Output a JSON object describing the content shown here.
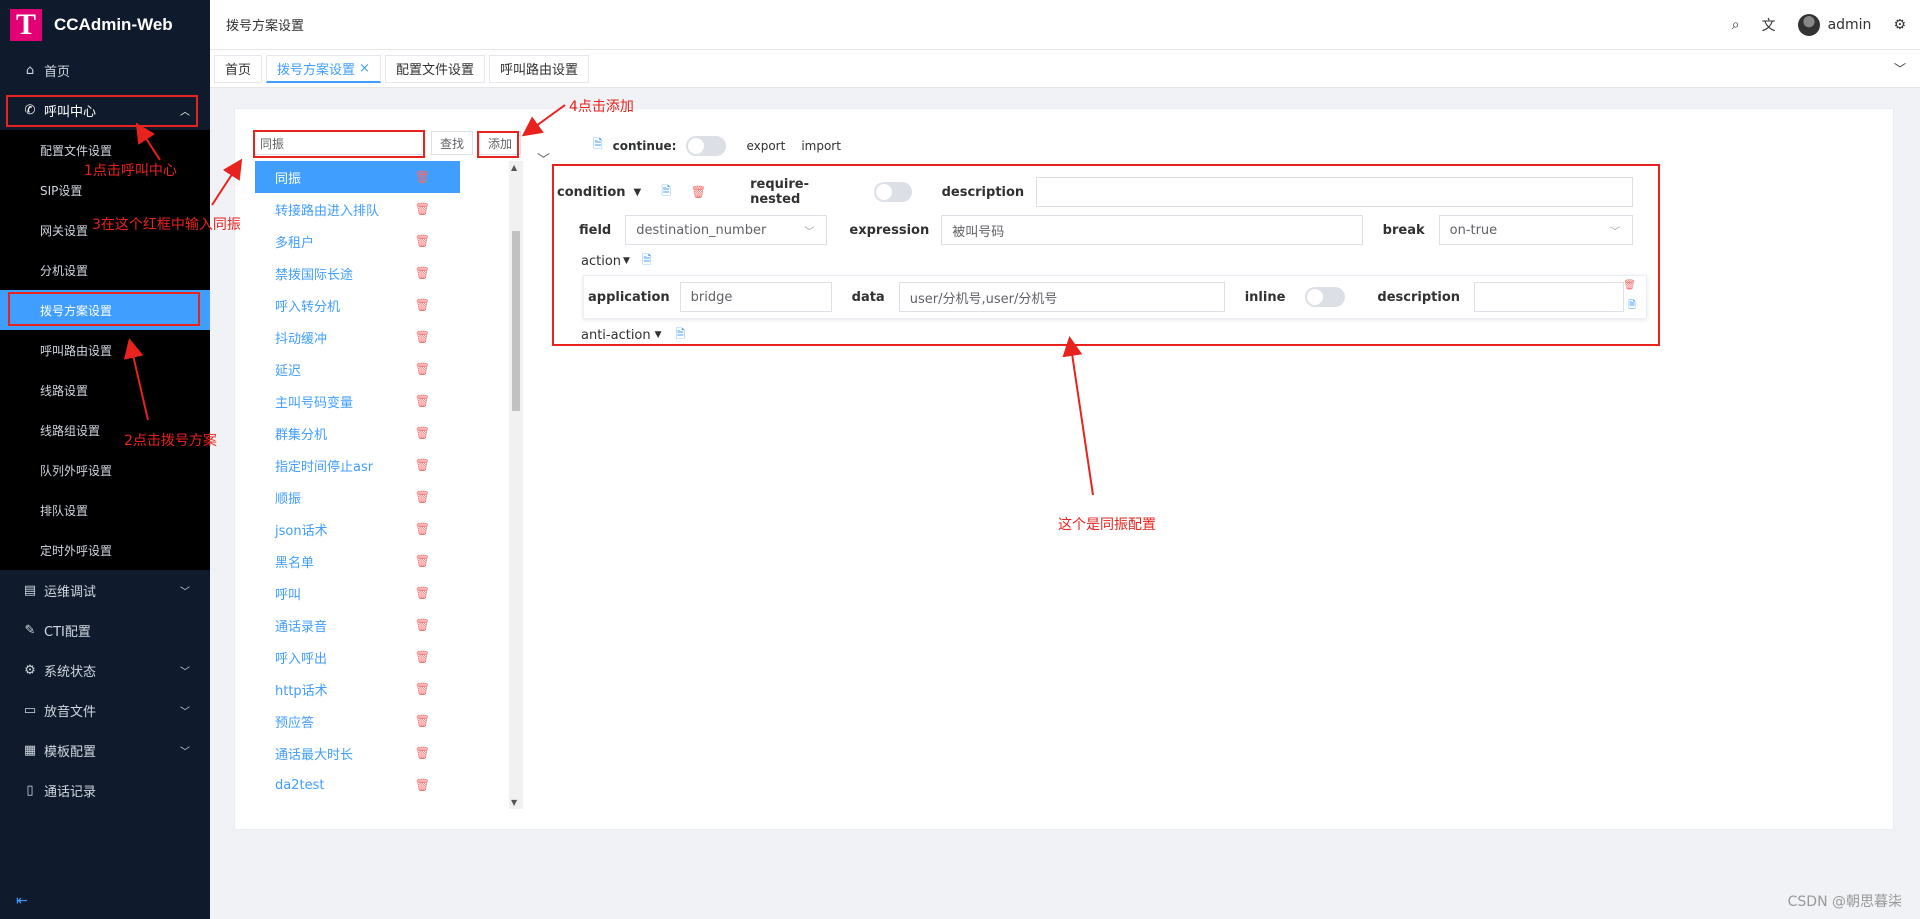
{
  "app": {
    "logo_letter": "T",
    "title": "CCAdmin-Web",
    "brand_color": "#e20074",
    "accent": "#409eff"
  },
  "sidebar": {
    "home": "首页",
    "callcenter": "呼叫中心",
    "sub_items": [
      "配置文件设置",
      "SIP设置",
      "网关设置",
      "分机设置",
      "拨号方案设置",
      "呼叫路由设置",
      "线路设置",
      "线路组设置",
      "队列外呼设置",
      "排队设置",
      "定时外呼设置"
    ],
    "ops": "运维调试",
    "cti": "CTI配置",
    "system": "系统状态",
    "audio": "放音文件",
    "template": "模板配置",
    "records": "通话记录"
  },
  "header": {
    "breadcrumb": "拨号方案设置",
    "user": "admin"
  },
  "tabs": [
    "首页",
    "拨号方案设置",
    "配置文件设置",
    "呼叫路由设置"
  ],
  "tab_close": "×",
  "search": {
    "value": "同振",
    "find_label": "查找",
    "add_label": "添加"
  },
  "dialplans": [
    "同振",
    "转接路由进入排队",
    "多租户",
    "禁拨国际长途",
    "呼入转分机",
    "抖动缓冲",
    "延迟",
    "主叫号码变量",
    "群集分机",
    "指定时间停止asr",
    "顺振",
    "json话术",
    "黑名单",
    "呼叫",
    "通话录音",
    "呼入呼出",
    "http话术",
    "预应答",
    "通话最大时长",
    "da2test"
  ],
  "editor": {
    "continue_label": "continue:",
    "export_label": "export",
    "import_label": "import",
    "condition_label": "condition",
    "require_nested_label": "require-nested",
    "description_label": "description",
    "field_label": "field",
    "field_value": "destination_number",
    "expression_label": "expression",
    "expression_value": "被叫号码",
    "break_label": "break",
    "break_value": "on-true",
    "action_label": "action",
    "application_label": "application",
    "application_value": "bridge",
    "data_label": "data",
    "data_value": "user/分机号,user/分机号",
    "inline_label": "inline",
    "action_description_label": "description",
    "anti_action_label": "anti-action"
  },
  "annotations": {
    "step1": "1点击呼叫中心",
    "step2": "2点击拨号方案",
    "step3": "3在这个红框中输入同振",
    "step4": "4点击添加",
    "note": "这个是同振配置"
  },
  "watermark": "CSDN @朝思暮柒"
}
